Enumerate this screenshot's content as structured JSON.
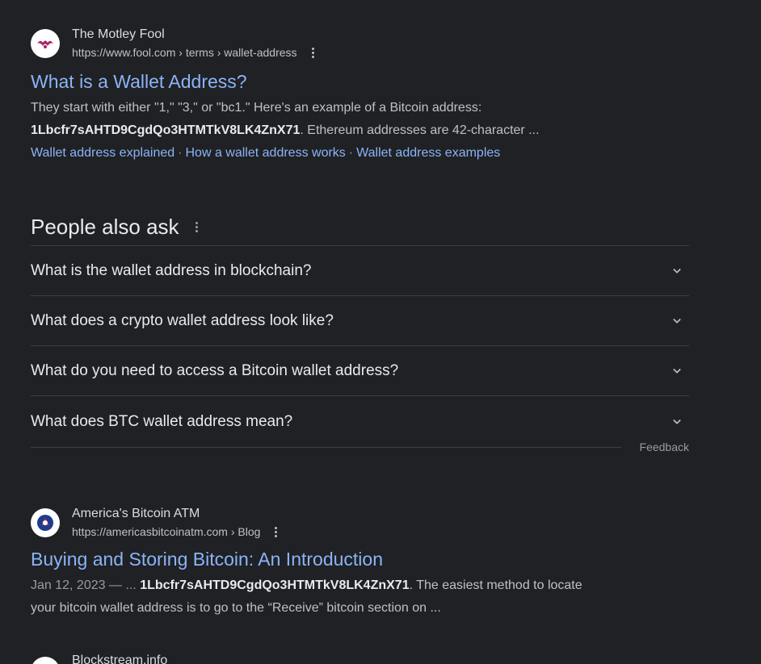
{
  "results": [
    {
      "site_name": "The Motley Fool",
      "url": "https://www.fool.com › terms › wallet-address",
      "title": "What is a Wallet Address?",
      "snippet_line1": "They start with either \"1,\" \"3,\" or \"bc1.\" Here's an example of a Bitcoin address:",
      "snippet_bold": "1Lbcfr7sAHTD9CgdQo3HTMTkV8LK4ZnX71",
      "snippet_line2_rest": ". Ethereum addresses are 42-character ...",
      "sitelinks": [
        "Wallet address explained",
        "How a wallet address works",
        "Wallet address examples"
      ],
      "sitelink_separator": "·"
    },
    {
      "site_name": "America's Bitcoin ATM",
      "url": "https://americasbitcoinatm.com › Blog",
      "title": "Buying and Storing Bitcoin: An Introduction",
      "date": "Jan 12, 2023 — ... ",
      "snippet_bold": "1Lbcfr7sAHTD9CgdQo3HTMTkV8LK4ZnX71",
      "snippet_line1_rest": ". The easiest method to locate",
      "snippet_line2": "your bitcoin wallet address is to go to the “Receive” bitcoin section on ..."
    },
    {
      "site_name": "Blockstream.info"
    }
  ],
  "people_also_ask": {
    "heading": "People also ask",
    "questions": [
      "What is the wallet address in blockchain?",
      "What does a crypto wallet address look like?",
      "What do you need to access a Bitcoin wallet address?",
      "What does BTC wallet address mean?"
    ],
    "feedback_label": "Feedback"
  },
  "icons": {
    "result_menu": "more-vert-icon",
    "paa_expand": "chevron-down-icon"
  },
  "colors": {
    "background": "#202124",
    "link": "#8ab4f8",
    "text": "#bdc1c6",
    "heading": "#e8eaed",
    "divider": "#3c4043"
  }
}
